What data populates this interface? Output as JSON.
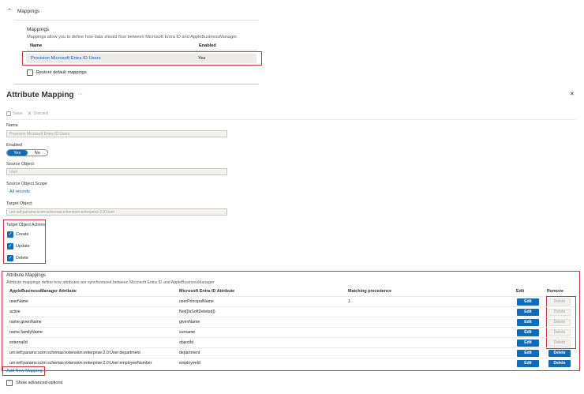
{
  "mappings_section": {
    "title": "Mappings",
    "heading": "Mappings",
    "description": "Mappings allow you to define how data should flow between Microsoft Entra ID and AppleBusinessManager.",
    "col_name": "Name",
    "col_enabled": "Enabled",
    "row_name": "Provision Microsoft Entra ID Users",
    "row_enabled": "Yes",
    "restore_label": "Restore default mappings"
  },
  "panel": {
    "title": "Attribute Mapping",
    "more": "···",
    "close": "✕",
    "toolbar": {
      "save": "Save",
      "discard": "Discard"
    }
  },
  "form": {
    "name_label": "Name",
    "name_value": "Provision Microsoft Entra ID Users",
    "enabled_label": "Enabled",
    "enabled_yes": "Yes",
    "enabled_no": "No",
    "source_object_label": "Source Object",
    "source_object_value": "User",
    "source_scope_label": "Source Object Scope",
    "source_scope_link": "All records",
    "target_object_label": "Target Object",
    "target_object_value": "urn:ietf:params:scim:schemas:extension:enterprise:2.0:User",
    "target_actions_label": "Target Object Actions",
    "actions": [
      "Create",
      "Update",
      "Delete"
    ]
  },
  "attr": {
    "title": "Attribute Mappings",
    "description": "Attribute mappings define how attributes are synchronized between Microsoft Entra ID and AppleBusinessManager",
    "headers": {
      "target": "AppleBusinessManager Attribute",
      "source": "Microsoft Entra ID Attribute",
      "precedence": "Matching precedence",
      "edit": "Edit",
      "remove": "Remove"
    },
    "rows": [
      {
        "target": "userName",
        "source": "userPrincipalName",
        "precedence": "1",
        "edit": "Edit",
        "remove": "Delete"
      },
      {
        "target": "active",
        "source": "Not([IsSoftDeleted])",
        "precedence": "",
        "edit": "Edit",
        "remove": "Delete"
      },
      {
        "target": "name.givenName",
        "source": "givenName",
        "precedence": "",
        "edit": "Edit",
        "remove": "Delete"
      },
      {
        "target": "name.familyName",
        "source": "surname",
        "precedence": "",
        "edit": "Edit",
        "remove": "Delete"
      },
      {
        "target": "externalId",
        "source": "objectId",
        "precedence": "",
        "edit": "Edit",
        "remove": "Delete"
      },
      {
        "target": "urn:ietf:params:scim:schemas:extension:enterprise:2.0:User:department",
        "source": "department",
        "precedence": "",
        "edit": "Edit",
        "remove": "Delete"
      },
      {
        "target": "urn:ietf:params:scim:schemas:extension:enterprise:2.0:User:employeeNumber",
        "source": "employeeId",
        "precedence": "",
        "edit": "Edit",
        "remove": "Delete"
      }
    ],
    "add_new": "Add New Mapping",
    "advanced": "Show advanced options"
  },
  "colors": {
    "accent": "#0f6cbd",
    "highlight": "#d13438"
  },
  "icons": [
    "chevron-up-icon",
    "save-icon",
    "discard-icon",
    "close-icon",
    "more-icon",
    "check-icon"
  ]
}
